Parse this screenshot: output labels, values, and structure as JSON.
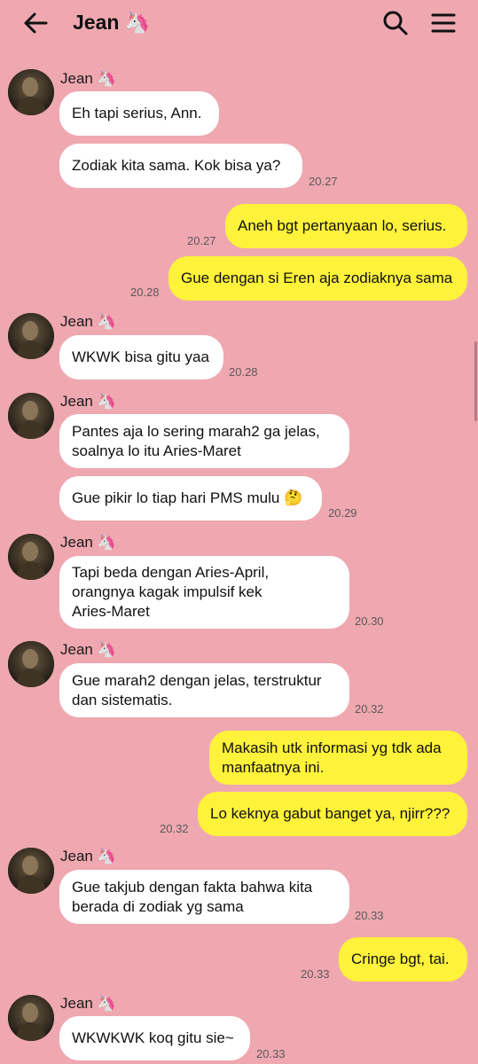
{
  "header": {
    "title": "Jean 🦄",
    "back_icon": "arrow-left-icon",
    "search_icon": "search-icon",
    "menu_icon": "hamburger-menu-icon"
  },
  "colors": {
    "background": "#efa8b0",
    "incoming_bubble": "#ffffff",
    "outgoing_bubble": "#fff23a"
  },
  "messages": {
    "g1": {
      "sender": "Jean 🦄",
      "m1": "Eh tapi serius, Ann.",
      "m2": "Zodiak kita sama. Kok bisa ya?",
      "time": "20.27"
    },
    "o1": {
      "m1": "Aneh bgt pertanyaan lo, serius.",
      "m1_time": "20.27",
      "m2": "Gue dengan si Eren aja zodiaknya sama",
      "m2_time": "20.28"
    },
    "g2": {
      "sender": "Jean 🦄",
      "m1": "WKWK bisa gitu yaa",
      "time": "20.28"
    },
    "g3": {
      "sender": "Jean 🦄",
      "m1_l1": "Pantes aja lo sering marah2 ga jelas,",
      "m1_l2": "soalnya lo itu Aries-Maret",
      "m2": "Gue pikir lo tiap hari PMS mulu 🤔",
      "time": "20.29"
    },
    "g4": {
      "sender": "Jean 🦄",
      "m1_l1": "Tapi beda dengan Aries-April,",
      "m1_l2": "orangnya kagak impulsif kek",
      "m1_l3": "Aries-Maret",
      "time": "20.30"
    },
    "g5": {
      "sender": "Jean 🦄",
      "m1_l1": "Gue marah2 dengan jelas, terstruktur",
      "m1_l2": "dan sistematis.",
      "time": "20.32"
    },
    "o2": {
      "m1_l1": "Makasih utk informasi yg tdk ada",
      "m1_l2": "manfaatnya ini.",
      "m2": "Lo keknya gabut banget ya, njirr???",
      "time": "20.32"
    },
    "g6": {
      "sender": "Jean 🦄",
      "m1_l1": "Gue takjub dengan fakta bahwa kita",
      "m1_l2": "berada di zodiak yg sama",
      "time": "20.33"
    },
    "o3": {
      "m1": "Cringe bgt, tai.",
      "time": "20.33"
    },
    "g7": {
      "sender": "Jean 🦄",
      "m1": "WKWKWK koq gitu sie~",
      "time": "20.33"
    }
  }
}
